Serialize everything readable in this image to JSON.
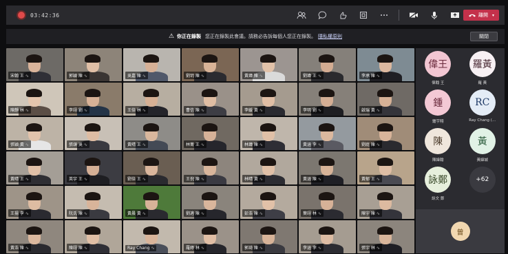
{
  "toolbar": {
    "timer": "03:42:36",
    "leave_label": "離開",
    "icons": [
      "participants-icon",
      "chat-icon",
      "reactions-icon",
      "share-tray-icon",
      "more-icon",
      "camera-icon",
      "mic-icon",
      "share-screen-icon"
    ]
  },
  "banner": {
    "warn_icon": "⚠",
    "bold_text": "你正在錄製",
    "text": "您正在錄製此會議。請務必告訴每個人您正在錄製。",
    "link_text": "隱私權原則",
    "dismiss_label": "關閉"
  },
  "tiles": [
    {
      "name": "宋翰 王",
      "bg": "#6d6a66",
      "skin": "#d9b39a",
      "shirt": "#2f2f36"
    },
    {
      "name": "郭穎 陳",
      "bg": "#8d8479",
      "skin": "#e0bfa6",
      "shirt": "#3a3533"
    },
    {
      "name": "吳嘉 陳",
      "bg": "#b9b5af",
      "skin": "#d6b096",
      "shirt": "#50586a"
    },
    {
      "name": "劉玥 陳",
      "bg": "#7b6654",
      "skin": "#d8b397",
      "shirt": "#2b2b30"
    },
    {
      "name": "黃瑋 陳",
      "bg": "#9c9591",
      "skin": "#e2c2a9",
      "shirt": "#dadada"
    },
    {
      "name": "劉瑋 王",
      "bg": "#85807a",
      "skin": "#d3ac92",
      "shirt": "#2a2a2e"
    },
    {
      "name": "李承 陳",
      "bg": "#7e8b93",
      "skin": "#dcb89f",
      "shirt": "#1f1f24"
    },
    {
      "name": "陳靜 林",
      "bg": "#cfc6b9",
      "skin": "#e5c6ae",
      "shirt": "#5b4e46"
    },
    {
      "name": "李翊 劉",
      "bg": "#8a7b6a",
      "skin": "#d7b196",
      "shirt": "#243447"
    },
    {
      "name": "王倍 林",
      "bg": "#b7aea1",
      "skin": "#d6b094",
      "shirt": "#24242a"
    },
    {
      "name": "曹信 陳",
      "bg": "#9a9189",
      "skin": "#dfbda3",
      "shirt": "#3d3d44"
    },
    {
      "name": "李媛 黃",
      "bg": "#a59b8f",
      "skin": "#e0bea5",
      "shirt": "#2a2a30"
    },
    {
      "name": "李明 劉",
      "bg": "#868079",
      "skin": "#d4ae94",
      "shirt": "#1e1e22"
    },
    {
      "name": "啟瑞 黃",
      "bg": "#6f6a65",
      "skin": "#d6b196",
      "shirt": "#34343a"
    },
    {
      "name": "張穎 黃",
      "bg": "#bdb3a6",
      "skin": "#e2c3ab",
      "shirt": "#e6e6e6"
    },
    {
      "name": "張頌 吳",
      "bg": "#c8c0b6",
      "skin": "#ddbca3",
      "shirt": "#3a3a40"
    },
    {
      "name": "黃晴 王",
      "bg": "#8e8c88",
      "skin": "#d9b79d",
      "shirt": "#444a55"
    },
    {
      "name": "林菁 王",
      "bg": "#706961",
      "skin": "#d6b298",
      "shirt": "#26262c"
    },
    {
      "name": "林瑋 陳",
      "bg": "#bfb6ab",
      "skin": "#e0c0a7",
      "shirt": "#2e2e35"
    },
    {
      "name": "黃涵 李",
      "bg": "#949a9f",
      "skin": "#dbb89e",
      "shirt": "#5a5a62"
    },
    {
      "name": "劉庭 陳",
      "bg": "#a08c78",
      "skin": "#d8b49a",
      "shirt": "#2a2a2f"
    },
    {
      "name": "黃晴 王",
      "bg": "#a49e96",
      "skin": "#e1c1a8",
      "shirt": "#2e2e33"
    },
    {
      "name": "英宇 王",
      "bg": "#3c3c42",
      "skin": "#d5af95",
      "shirt": "#1e1e22"
    },
    {
      "name": "劉倍 王",
      "bg": "#6a5e52",
      "skin": "#dab69c",
      "shirt": "#2a2a2f"
    },
    {
      "name": "王倪 陳",
      "bg": "#8d857d",
      "skin": "#d8b59b",
      "shirt": "#3a3a42"
    },
    {
      "name": "林晴 黃",
      "bg": "#b1a89d",
      "skin": "#e0c0a7",
      "shirt": "#2c2c32"
    },
    {
      "name": "黃涵 陳",
      "bg": "#7c7770",
      "skin": "#d7b398",
      "shirt": "#1f1f25"
    },
    {
      "name": "黃郁 王",
      "bg": "#b8a48b",
      "skin": "#dfbea5",
      "shirt": "#4a4a52"
    },
    {
      "name": "王揚 李",
      "bg": "#9e9488",
      "skin": "#ddbca2",
      "shirt": "#2a2a30"
    },
    {
      "name": "阮氏 陳",
      "bg": "#c5bcb0",
      "skin": "#d8b49a",
      "shirt": "#3a3a40"
    },
    {
      "name": "黃晨 黃",
      "bg": "#4e7a3a",
      "skin": "#d7b398",
      "shirt": "#2a2a2f"
    },
    {
      "name": "劉適 陳",
      "bg": "#8a847c",
      "skin": "#d9b69c",
      "shirt": "#26262c"
    },
    {
      "name": "彭浩 陳",
      "bg": "#b4aa9e",
      "skin": "#e1c1a8",
      "shirt": "#3e3e46"
    },
    {
      "name": "葉翊 林",
      "bg": "#7a736c",
      "skin": "#d6b197",
      "shirt": "#2b2b31"
    },
    {
      "name": "陳宇 陳",
      "bg": "#a89f94",
      "skin": "#dcbaa0",
      "shirt": "#34343b"
    },
    {
      "name": "黃浩 陳",
      "bg": "#8f877e",
      "skin": "#dbb89e",
      "shirt": "#2a2a2f"
    },
    {
      "name": "陳翊 陳",
      "bg": "#b0a699",
      "skin": "#e0bfa6",
      "shirt": "#2f2f36"
    },
    {
      "name": "Ray Chang",
      "bg": "#c2b9ad",
      "skin": "#d8b49a",
      "shirt": "#4a4f5a"
    },
    {
      "name": "羅婷 林",
      "bg": "#9b9289",
      "skin": "#e0bea5",
      "shirt": "#26262c"
    },
    {
      "name": "郭琦 陳",
      "bg": "#7f7871",
      "skin": "#d7b398",
      "shirt": "#3a3a40"
    },
    {
      "name": "李涵 李",
      "bg": "#a59c91",
      "skin": "#ddbca3",
      "shirt": "#2c2c32"
    },
    {
      "name": "張宇 林",
      "bg": "#8c857d",
      "skin": "#d8b59b",
      "shirt": "#1f1f25"
    }
  ],
  "side_avatars": [
    {
      "text": "偉王",
      "name": "偉翰 王",
      "bg": "#f2c6d2",
      "fg": "#6a2a3c"
    },
    {
      "text": "羅黃",
      "name": "羅 黃",
      "bg": "#f7f0f3",
      "fg": "#4a2a35"
    },
    {
      "text": "鍾",
      "name": "鍾宇翔",
      "bg": "#f3c8d4",
      "fg": "#6a2a3c"
    },
    {
      "text": "RC",
      "name": "Ray Chang (...",
      "bg": "#e4ecf6",
      "fg": "#1f3a66"
    },
    {
      "text": "陳",
      "name": "陳緯翰",
      "bg": "#efe6dc",
      "fg": "#4a3a2a"
    },
    {
      "text": "黃",
      "name": "黃緯城",
      "bg": "#e1f2e6",
      "fg": "#2a5a3a"
    },
    {
      "text": "詠鄭",
      "name": "詠文 鄭",
      "bg": "#e6efdc",
      "fg": "#3a4a2a"
    },
    {
      "text": "+62",
      "name": "",
      "bg": "#3a3a40",
      "fg": "#ffffff"
    }
  ],
  "self_view": {
    "text": "曾",
    "bg": "#f1d7b0",
    "fg": "#6a4a1a"
  }
}
